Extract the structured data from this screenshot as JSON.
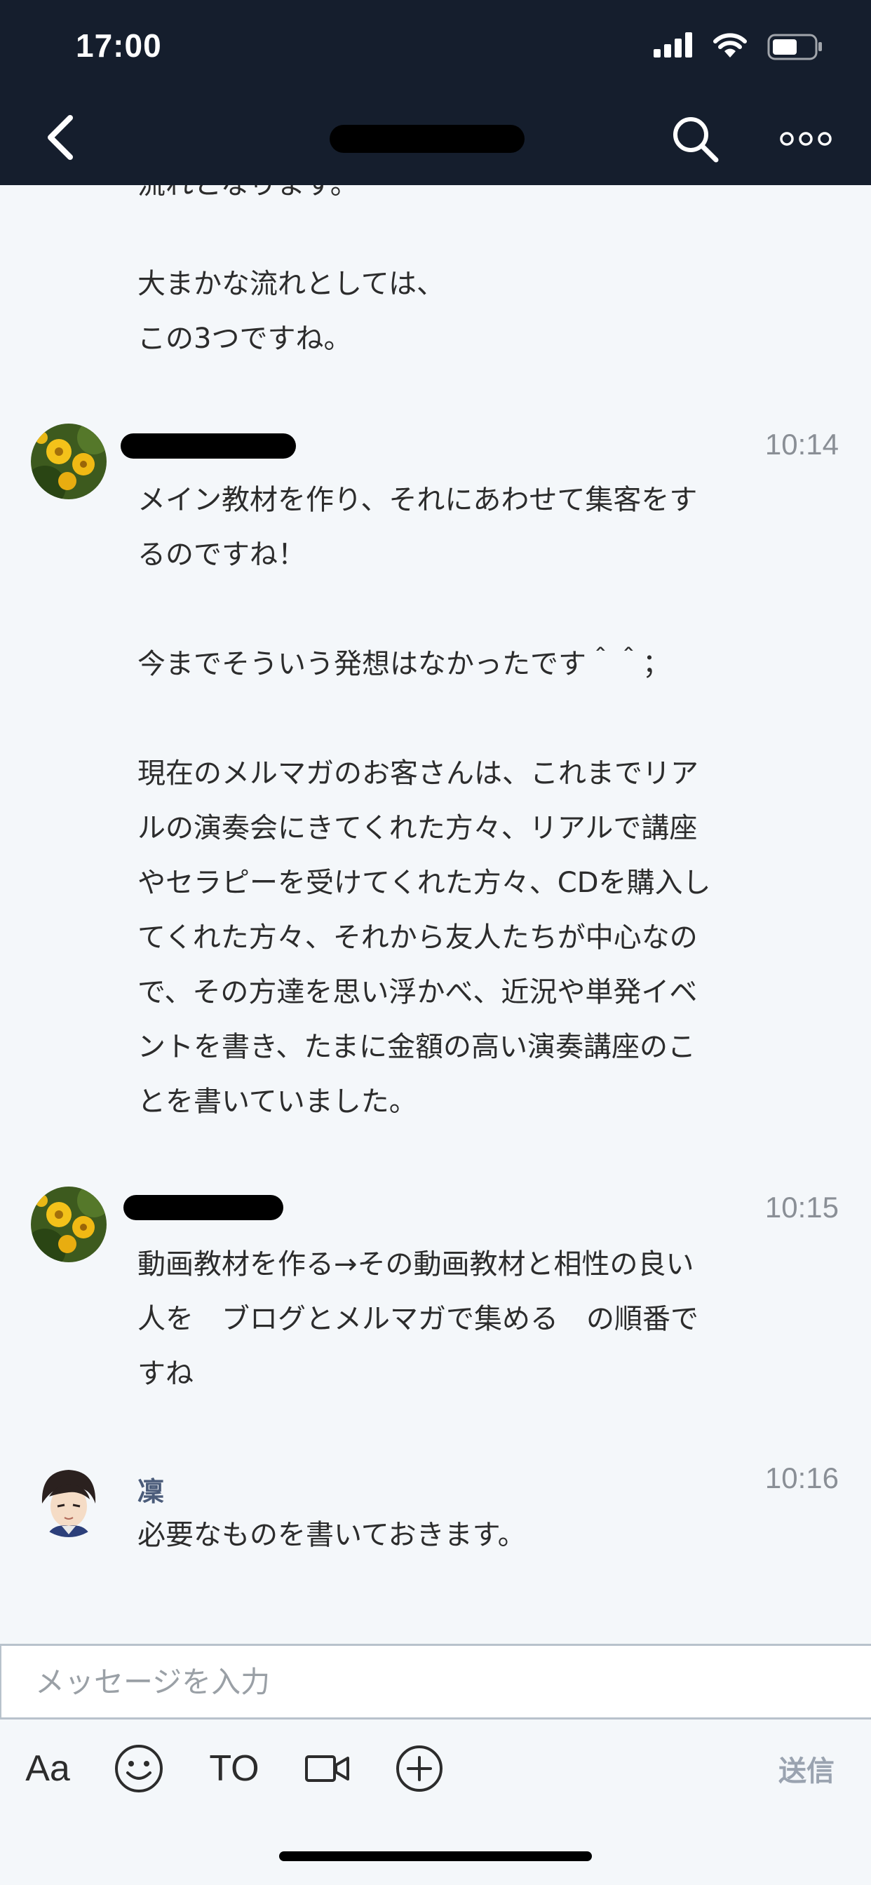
{
  "status_bar": {
    "time": "17:00"
  },
  "header": {
    "back_icon": "chevron-left-icon",
    "search_icon": "search-icon",
    "more_icon": "more-icon"
  },
  "messages": [
    {
      "partial_text": "流れとなります。",
      "text": "大まかな流れとしては、\nこの3つですね。"
    },
    {
      "time": "10:14",
      "text": "メイン教材を作り、それにあわせて集客をす\nるのですね！\n\n今までそういう発想はなかったです＾＾；\n\n現在のメルマガのお客さんは、これまでリア\nルの演奏会にきてくれた方々、リアルで講座\nやセラピーを受けてくれた方々、CDを購入し\nてくれた方々、それから友人たちが中心なの\nで、その方達を思い浮かべ、近況や単発イベ\nントを書き、たまに金額の高い演奏講座のこ\nとを書いていました。"
    },
    {
      "time": "10:15",
      "text": "動画教材を作る→その動画教材と相性の良い\n人を　ブログとメルマガで集める　の順番で\nすね"
    },
    {
      "sender": "凜",
      "time": "10:16",
      "text": "必要なものを書いておきます。"
    }
  ],
  "input": {
    "placeholder": "メッセージを入力",
    "value": ""
  },
  "toolbar": {
    "format_label": "Aa",
    "emoji_icon": "smiley-icon",
    "to_label": "TO",
    "video_icon": "video-camera-icon",
    "add_icon": "plus-circle-icon",
    "send_label": "送信"
  },
  "colors": {
    "header_bg": "#151e2d",
    "chat_bg": "#f4f7fa",
    "sender_name": "#4b5c7a",
    "timestamp": "#8a8f96",
    "send_disabled": "#9aa3b0"
  }
}
